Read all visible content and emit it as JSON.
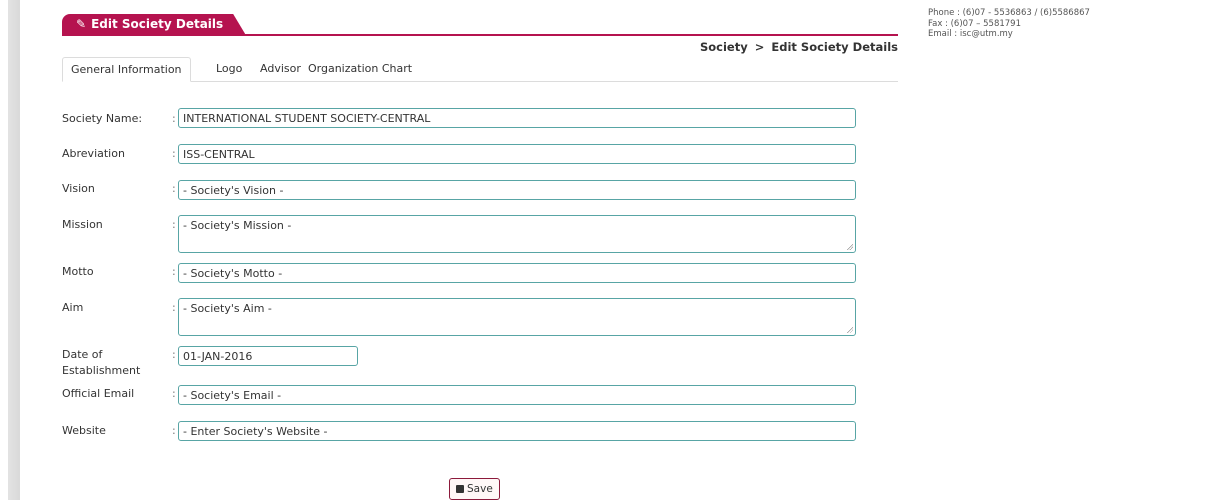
{
  "panel": {
    "title": "Edit Society Details",
    "title_icon": "edit-icon"
  },
  "breadcrumb": {
    "root": "Society",
    "separator": ">",
    "current": "Edit Society Details"
  },
  "contact": {
    "phone": "Phone : (6)07 - 5536863 / (6)5586867",
    "fax": "Fax : (6)07 – 5581791",
    "email": "Email : isc@utm.my"
  },
  "tabs": [
    "General Information",
    "Logo",
    "Advisor",
    "Organization Chart"
  ],
  "form": {
    "separator": ":",
    "society_name": {
      "label": "Society Name:",
      "value": "INTERNATIONAL STUDENT SOCIETY-CENTRAL"
    },
    "abbreviation": {
      "label": "Abreviation",
      "value": "ISS-CENTRAL"
    },
    "vision": {
      "label": "Vision",
      "value": "- Society's Vision -"
    },
    "mission": {
      "label": "Mission",
      "value": "- Society's Mission -"
    },
    "motto": {
      "label": "Motto",
      "value": "- Society's Motto -"
    },
    "aim": {
      "label": "Aim",
      "value": "- Society's Aim -"
    },
    "date_established": {
      "label_line1": "Date of",
      "label_line2": "Establishment",
      "value": "01-JAN-2016"
    },
    "official_email": {
      "label": "Official Email",
      "value": "- Society's Email -"
    },
    "website": {
      "label": "Website",
      "value": "- Enter Society's Website -"
    }
  },
  "save_button": {
    "label": "Save",
    "icon": "floppy-disk-icon"
  },
  "colors": {
    "accent": "#b5134f",
    "field_border": "#58a5a5"
  }
}
